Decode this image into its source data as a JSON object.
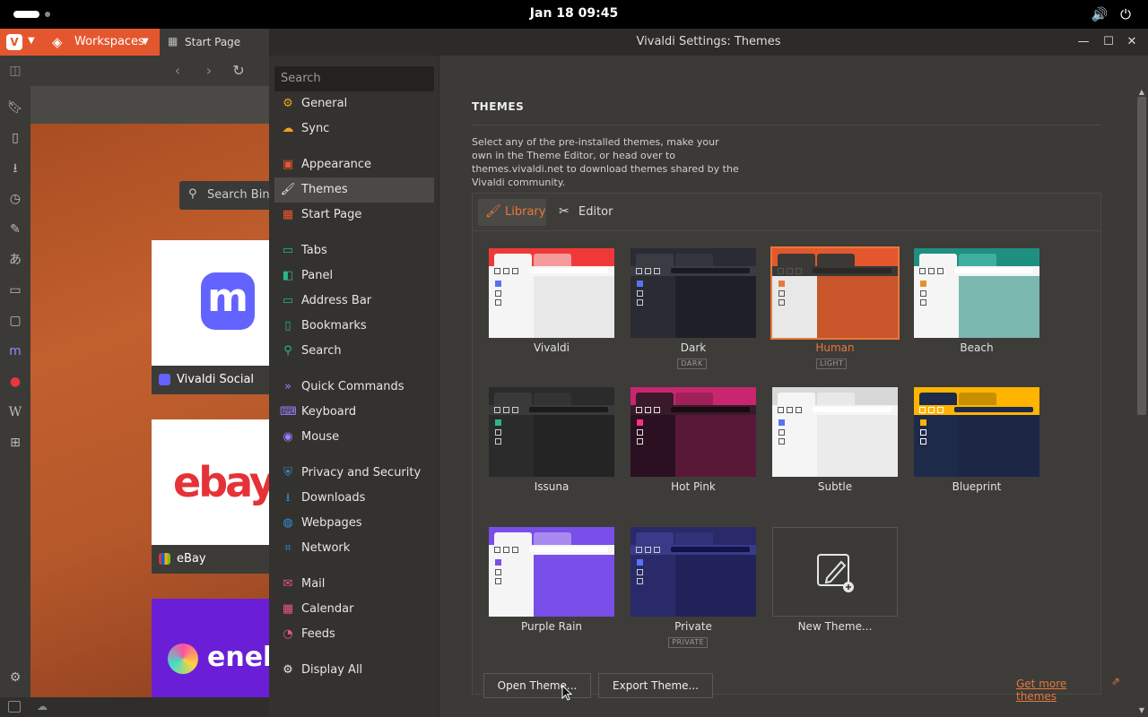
{
  "system": {
    "clock": "Jan 18  09:45",
    "icons": [
      "volume-icon",
      "power-icon"
    ]
  },
  "browser": {
    "workspaces_label": "Workspaces",
    "tab_label": "Start Page",
    "search_bing_label": "Search Bing",
    "speed_dials": [
      {
        "label": "Vivaldi Social",
        "logo_text": "m",
        "color": "#6364ff"
      },
      {
        "label": "eBay",
        "logo_text": "ebay"
      },
      {
        "label": "eneba",
        "logo_text": "eneb"
      }
    ]
  },
  "dialog": {
    "title": "Vivaldi Settings: Themes",
    "search_placeholder": "Search",
    "nav": [
      {
        "label": "General",
        "icon": "gear-icon",
        "color": "#f0a020"
      },
      {
        "label": "Sync",
        "icon": "cloud-icon",
        "color": "#f0a020"
      },
      {
        "label": "Appearance",
        "icon": "appearance-icon",
        "color": "#e8572e"
      },
      {
        "label": "Themes",
        "icon": "brush-icon",
        "color": "#e6e6e6"
      },
      {
        "label": "Start Page",
        "icon": "grid-icon",
        "color": "#e8572e"
      },
      {
        "label": "Tabs",
        "icon": "tabs-icon",
        "color": "#2fb38c"
      },
      {
        "label": "Panel",
        "icon": "panel-icon",
        "color": "#2fb38c"
      },
      {
        "label": "Address Bar",
        "icon": "address-bar-icon",
        "color": "#2fb38c"
      },
      {
        "label": "Bookmarks",
        "icon": "bookmark-icon",
        "color": "#2fb38c"
      },
      {
        "label": "Search",
        "icon": "search-icon",
        "color": "#2fb38c"
      },
      {
        "label": "Quick Commands",
        "icon": "quick-commands-icon",
        "color": "#9b7dff"
      },
      {
        "label": "Keyboard",
        "icon": "keyboard-icon",
        "color": "#9b7dff"
      },
      {
        "label": "Mouse",
        "icon": "mouse-icon",
        "color": "#9b7dff"
      },
      {
        "label": "Privacy and Security",
        "icon": "shield-icon",
        "color": "#3a8de0"
      },
      {
        "label": "Downloads",
        "icon": "download-icon",
        "color": "#3a8de0"
      },
      {
        "label": "Webpages",
        "icon": "globe-icon",
        "color": "#3a8de0"
      },
      {
        "label": "Network",
        "icon": "network-icon",
        "color": "#3a8de0"
      },
      {
        "label": "Mail",
        "icon": "mail-icon",
        "color": "#e8577e"
      },
      {
        "label": "Calendar",
        "icon": "calendar-icon",
        "color": "#e8577e"
      },
      {
        "label": "Feeds",
        "icon": "feed-icon",
        "color": "#e8577e"
      },
      {
        "label": "Display All",
        "icon": "gear-icon",
        "color": "#e6e6e6"
      }
    ],
    "heading": "THEMES",
    "description": "Select any of the pre-installed themes, make your own in the Theme Editor, or head over to themes.vivaldi.net to download themes shared by the Vivaldi community.",
    "tabs": [
      {
        "label": "Library",
        "icon": "brush-icon"
      },
      {
        "label": "Editor",
        "icon": "editor-icon"
      }
    ],
    "themes": [
      {
        "name": "Vivaldi",
        "badge": "",
        "top": "#ef3939",
        "tab": "#f5f5f5",
        "tab2": "#f59a9a",
        "bar": "#f5f5f5",
        "url": "#ffffff",
        "side": "#f5f5f5",
        "main": "#e8e8e8",
        "sq": "#555555",
        "dot": "#5872f5"
      },
      {
        "name": "Dark",
        "badge": "DARK",
        "top": "#2a2b33",
        "tab": "#3a3b43",
        "tab2": "#34353d",
        "bar": "#3a3b43",
        "url": "#1a1b21",
        "side": "#2a2b33",
        "main": "#1f2027",
        "sq": "#cccccc",
        "dot": "#5872f5"
      },
      {
        "name": "Human",
        "badge": "LIGHT",
        "top": "#e4572e",
        "tab": "#3a3936",
        "tab2": "#3a3936",
        "bar": "#3a3936",
        "url": "#2a2926",
        "side": "#e8e8e8",
        "main": "#c8562a",
        "sq": "#555555",
        "dot": "#e8783c",
        "selected": true
      },
      {
        "name": "Beach",
        "badge": "",
        "top": "#1f8f80",
        "tab": "#f5f5f5",
        "tab2": "#3fb0a0",
        "bar": "#f5f5f5",
        "url": "#ffffff",
        "side": "#f5f5f5",
        "main": "#7ab8b0",
        "sq": "#555555",
        "dot": "#e89030"
      },
      {
        "name": "Issuna",
        "badge": "",
        "top": "#2b2b2b",
        "tab": "#3a3a3a",
        "tab2": "#333333",
        "bar": "#3a3a3a",
        "url": "#1a1a1a",
        "side": "#2b2b2b",
        "main": "#242424",
        "sq": "#cccccc",
        "dot": "#2fb38c"
      },
      {
        "name": "Hot Pink",
        "badge": "",
        "top": "#c8266e",
        "tab": "#3a1a2a",
        "tab2": "#a02058",
        "bar": "#3a1a2a",
        "url": "#1a0a12",
        "side": "#2a1020",
        "main": "#5a1838",
        "sq": "#dddddd",
        "dot": "#ff2e88"
      },
      {
        "name": "Subtle",
        "badge": "",
        "top": "#d8d8d8",
        "tab": "#f5f5f5",
        "tab2": "#e8e8e8",
        "bar": "#f5f5f5",
        "url": "#ffffff",
        "side": "#f5f5f5",
        "main": "#ebebeb",
        "sq": "#555555",
        "dot": "#5872f5"
      },
      {
        "name": "Blueprint",
        "badge": "",
        "top": "#ffb400",
        "tab": "#1e2a4a",
        "tab2": "#c89000",
        "bar": "#ffb400",
        "url": "#1e2a4a",
        "side": "#1e2a4a",
        "main": "#1a2644",
        "sq": "#ffffff",
        "dot": "#ffb400"
      },
      {
        "name": "Purple Rain",
        "badge": "",
        "top": "#7a4ee8",
        "tab": "#f5f5f5",
        "tab2": "#a88af0",
        "bar": "#f5f5f5",
        "url": "#ffffff",
        "side": "#f5f5f5",
        "main": "#7a4ee8",
        "sq": "#555555",
        "dot": "#7a4ee8"
      },
      {
        "name": "Private",
        "badge": "PRIVATE",
        "top": "#2a2a6a",
        "tab": "#3a3a8a",
        "tab2": "#32327a",
        "bar": "#3a3a8a",
        "url": "#12124a",
        "side": "#2a2a6a",
        "main": "#22225a",
        "sq": "#cccccc",
        "dot": "#5872f5"
      }
    ],
    "new_theme_label": "New Theme...",
    "open_theme_label": "Open Theme...",
    "export_theme_label": "Export Theme...",
    "get_more_label": "Get more themes"
  }
}
